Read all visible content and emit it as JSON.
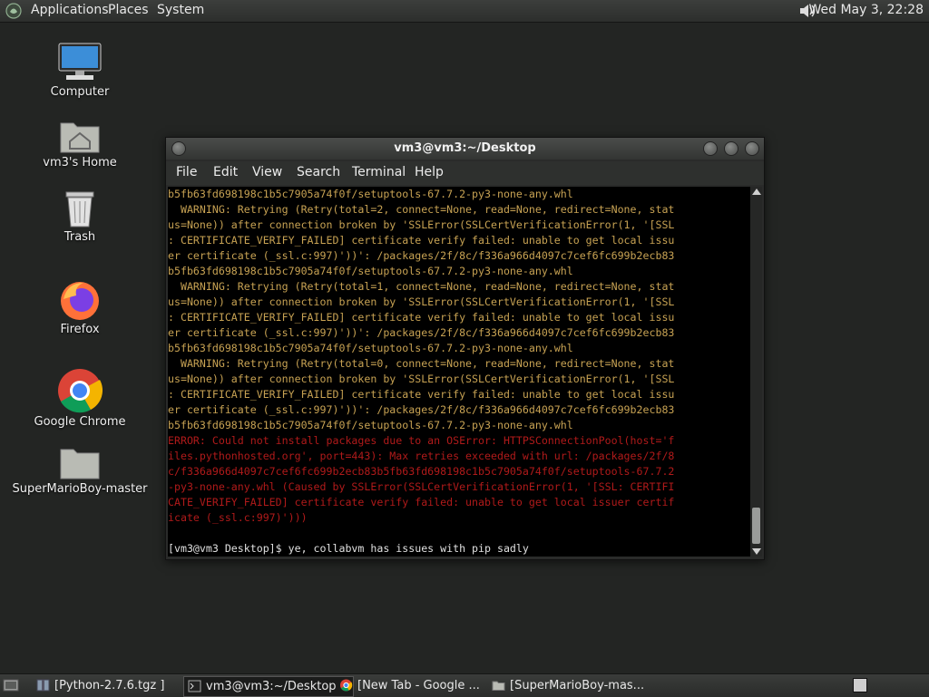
{
  "top_panel": {
    "menus": [
      "Applications",
      "Places",
      "System"
    ],
    "clock": "Wed May  3, 22:28"
  },
  "desktop_icons": [
    {
      "label": "Computer",
      "icon": "computer-icon"
    },
    {
      "label": "vm3's Home",
      "icon": "home-folder-icon"
    },
    {
      "label": "Trash",
      "icon": "trash-icon"
    },
    {
      "label": "Firefox",
      "icon": "firefox-icon"
    },
    {
      "label": "Google Chrome",
      "icon": "chrome-icon"
    },
    {
      "label": "SuperMarioBoy-master",
      "icon": "folder-icon"
    }
  ],
  "terminal": {
    "title": "vm3@vm3:~/Desktop",
    "menus": [
      "File",
      "Edit",
      "View",
      "Search",
      "Terminal",
      "Help"
    ],
    "lines": [
      {
        "cls": "warn",
        "text": "b5fb63fd698198c1b5c7905a74f0f/setuptools-67.7.2-py3-none-any.whl"
      },
      {
        "cls": "warn",
        "text": "  WARNING: Retrying (Retry(total=2, connect=None, read=None, redirect=None, stat"
      },
      {
        "cls": "warn",
        "text": "us=None)) after connection broken by 'SSLError(SSLCertVerificationError(1, '[SSL"
      },
      {
        "cls": "warn",
        "text": ": CERTIFICATE_VERIFY_FAILED] certificate verify failed: unable to get local issu"
      },
      {
        "cls": "warn",
        "text": "er certificate (_ssl.c:997)'))': /packages/2f/8c/f336a966d4097c7cef6fc699b2ecb83"
      },
      {
        "cls": "warn",
        "text": "b5fb63fd698198c1b5c7905a74f0f/setuptools-67.7.2-py3-none-any.whl"
      },
      {
        "cls": "warn",
        "text": "  WARNING: Retrying (Retry(total=1, connect=None, read=None, redirect=None, stat"
      },
      {
        "cls": "warn",
        "text": "us=None)) after connection broken by 'SSLError(SSLCertVerificationError(1, '[SSL"
      },
      {
        "cls": "warn",
        "text": ": CERTIFICATE_VERIFY_FAILED] certificate verify failed: unable to get local issu"
      },
      {
        "cls": "warn",
        "text": "er certificate (_ssl.c:997)'))': /packages/2f/8c/f336a966d4097c7cef6fc699b2ecb83"
      },
      {
        "cls": "warn",
        "text": "b5fb63fd698198c1b5c7905a74f0f/setuptools-67.7.2-py3-none-any.whl"
      },
      {
        "cls": "warn",
        "text": "  WARNING: Retrying (Retry(total=0, connect=None, read=None, redirect=None, stat"
      },
      {
        "cls": "warn",
        "text": "us=None)) after connection broken by 'SSLError(SSLCertVerificationError(1, '[SSL"
      },
      {
        "cls": "warn",
        "text": ": CERTIFICATE_VERIFY_FAILED] certificate verify failed: unable to get local issu"
      },
      {
        "cls": "warn",
        "text": "er certificate (_ssl.c:997)'))': /packages/2f/8c/f336a966d4097c7cef6fc699b2ecb83"
      },
      {
        "cls": "warn",
        "text": "b5fb63fd698198c1b5c7905a74f0f/setuptools-67.7.2-py3-none-any.whl"
      },
      {
        "cls": "err",
        "text": "ERROR: Could not install packages due to an OSError: HTTPSConnectionPool(host='f"
      },
      {
        "cls": "err",
        "text": "iles.pythonhosted.org', port=443): Max retries exceeded with url: /packages/2f/8"
      },
      {
        "cls": "err",
        "text": "c/f336a966d4097c7cef6fc699b2ecb83b5fb63fd698198c1b5c7905a74f0f/setuptools-67.7.2"
      },
      {
        "cls": "err",
        "text": "-py3-none-any.whl (Caused by SSLError(SSLCertVerificationError(1, '[SSL: CERTIFI"
      },
      {
        "cls": "err",
        "text": "CATE_VERIFY_FAILED] certificate verify failed: unable to get local issuer certif"
      },
      {
        "cls": "err",
        "text": "icate (_ssl.c:997)')))"
      },
      {
        "cls": "prompt",
        "text": ""
      },
      {
        "cls": "prompt",
        "text": "[vm3@vm3 Desktop]$ ye, collabvm has issues with pip sadly"
      }
    ]
  },
  "taskbar": [
    {
      "label": "[Python-2.7.6.tgz ]",
      "icon": "archive-icon",
      "active": false
    },
    {
      "label": "vm3@vm3:~/Desktop",
      "icon": "terminal-icon",
      "active": true
    },
    {
      "label": "[New Tab - Google ...",
      "icon": "chrome-icon",
      "active": false
    },
    {
      "label": "[SuperMarioBoy-mas...",
      "icon": "folder-icon",
      "active": false
    }
  ]
}
